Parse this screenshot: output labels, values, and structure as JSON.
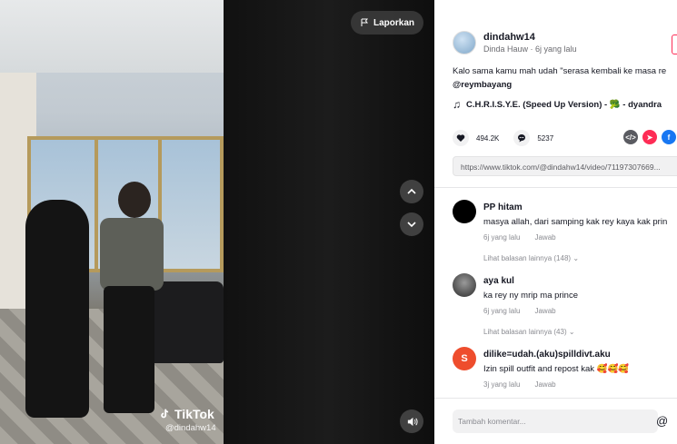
{
  "video": {
    "report_label": "Laporkan",
    "watermark_brand": "TikTok",
    "watermark_user": "@dindahw14"
  },
  "author": {
    "username": "dindahw14",
    "subtitle": "Dinda Hauw · 6j yang lalu"
  },
  "post": {
    "caption": "Kalo sama kamu mah udah \"serasa kembali ke masa re",
    "mention": "@reymbayang",
    "music": "C.H.R.I.S.Y.E. (Speed Up Version) - 🥦 - dyandra",
    "likes": "494.2K",
    "comments_count": "5237",
    "link": "https://www.tiktok.com/@dindahw14/video/71197307669..."
  },
  "comments": [
    {
      "name": "PP hitam",
      "text": "masya allah, dari samping kak rey kaya kak prin",
      "time": "6j yang lalu",
      "reply": "Jawab",
      "more_replies": "Lihat balasan lainnya (148)"
    },
    {
      "name": "aya kul",
      "text": "ka rey ny mrip ma prince",
      "time": "6j yang lalu",
      "reply": "Jawab",
      "more_replies": "Lihat balasan lainnya (43)"
    },
    {
      "name": "dilike=udah.(aku)spilldivt.aku",
      "text": "Izin spill outfit and repost kak 🥰🥰🥰",
      "time": "3j yang lalu",
      "reply": "Jawab"
    }
  ],
  "comment_input": {
    "placeholder": "Tambah komentar..."
  },
  "colors": {
    "accent": "#fe2c55",
    "facebook": "#1877f2",
    "embed": "#5a5b61",
    "share_red": "#fe2c55"
  }
}
